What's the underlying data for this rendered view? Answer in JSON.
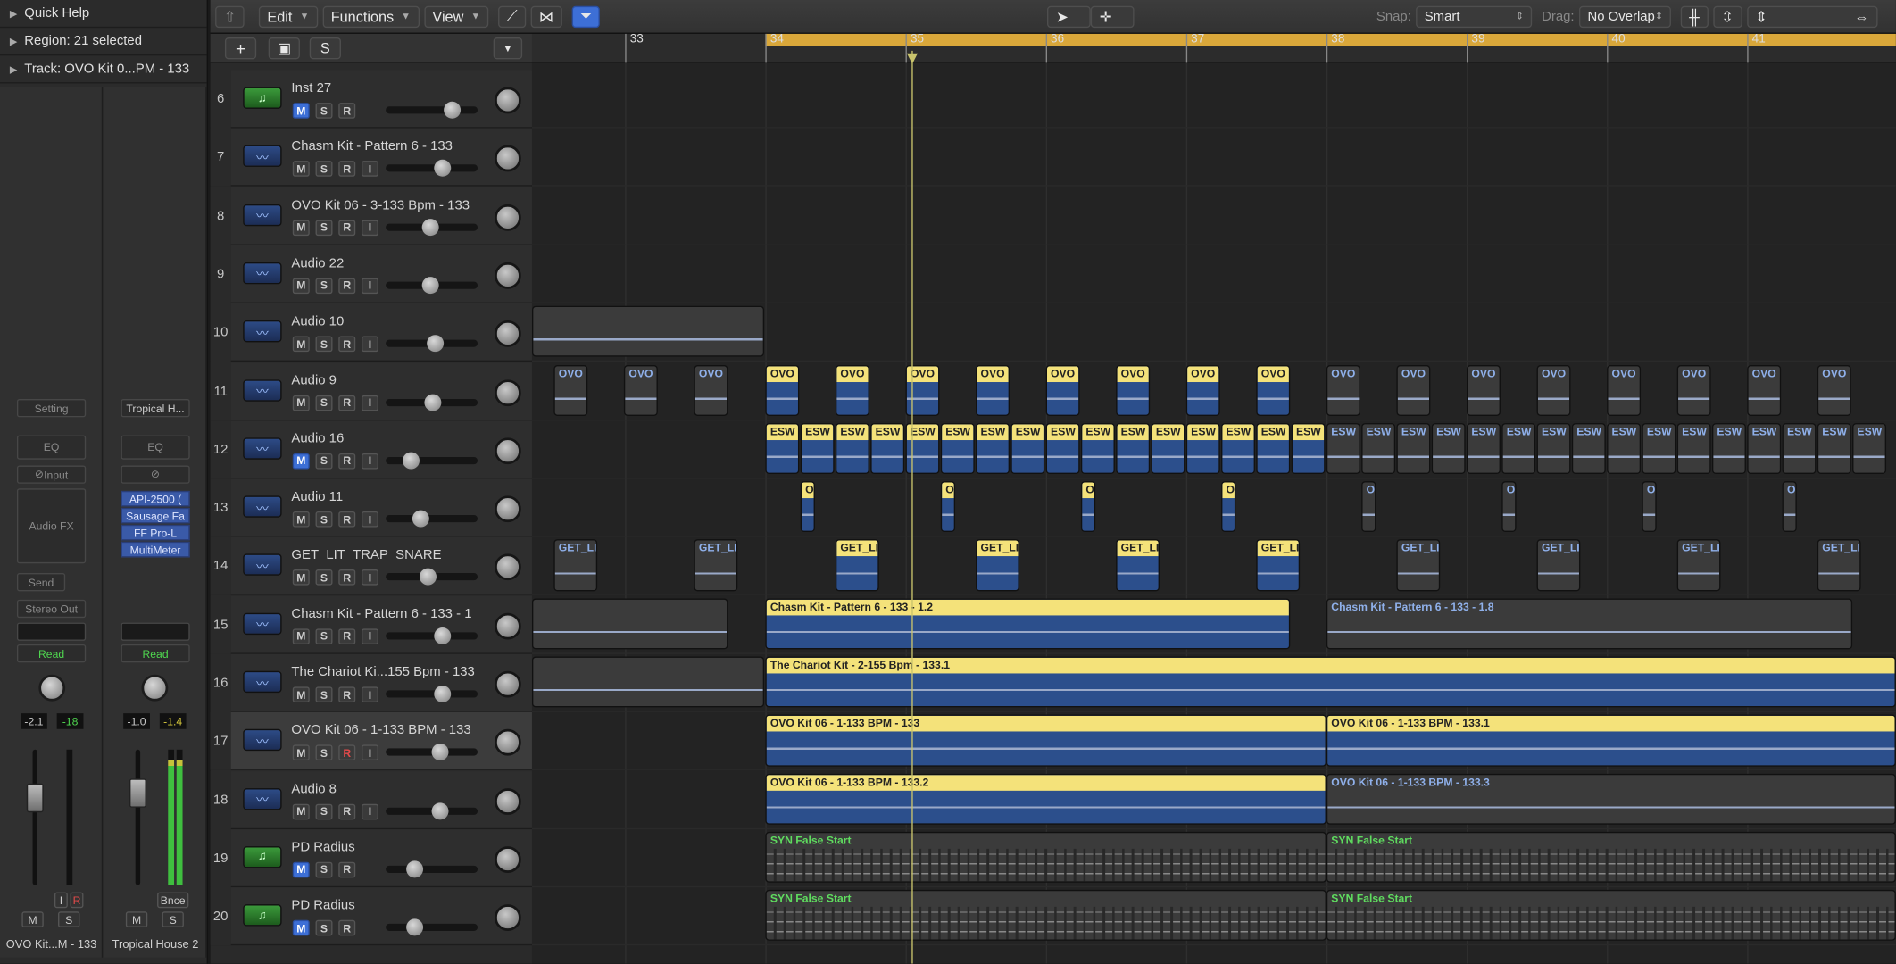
{
  "inspector": {
    "quick_help": "Quick Help",
    "region": "Region: 21 selected",
    "track": "Track:  OVO Kit 0...PM - 133",
    "strip1": {
      "setting": "Setting",
      "eq": "EQ",
      "input": "Input",
      "audio_fx": "Audio FX",
      "send": "Send",
      "output": "Stereo Out",
      "automation": "Read",
      "knob_val": "-18",
      "vol": "-2.1",
      "peak": "-18",
      "m": "M",
      "s": "S",
      "i": "I",
      "r": "R",
      "name": "OVO Kit...M - 133"
    },
    "strip2": {
      "setting": "Tropical H...",
      "eq": "EQ",
      "plugins": [
        "API-2500 (",
        "Sausage Fa",
        "FF Pro-L",
        "MultiMeter"
      ],
      "automation": "Read",
      "vol": "-1.0",
      "peak": "-1.4",
      "bnce": "Bnce",
      "m": "M",
      "s": "S",
      "name": "Tropical House 2"
    }
  },
  "toolbar": {
    "edit": "Edit",
    "functions": "Functions",
    "view": "View",
    "snap_label": "Snap:",
    "snap_value": "Smart",
    "drag_label": "Drag:",
    "drag_value": "No Overlap"
  },
  "header": {
    "add": "+",
    "s": "S"
  },
  "ruler": {
    "bars": [
      "33",
      "34",
      "35",
      "36",
      "37",
      "38",
      "39",
      "40",
      "41"
    ]
  },
  "tracks": [
    {
      "num": "6",
      "name": "Inst 27",
      "type": "midi",
      "btns": [
        "M",
        "S",
        "R"
      ],
      "vol": 0.78
    },
    {
      "num": "7",
      "name": "Chasm Kit - Pattern 6 - 133",
      "type": "audio",
      "btns": [
        "M",
        "S",
        "R",
        "I"
      ],
      "vol": 0.65
    },
    {
      "num": "8",
      "name": "OVO Kit 06 - 3-133 Bpm - 133",
      "type": "audio",
      "btns": [
        "M",
        "S",
        "R",
        "I"
      ],
      "vol": 0.48
    },
    {
      "num": "9",
      "name": "Audio 22",
      "type": "audio",
      "btns": [
        "M",
        "S",
        "R",
        "I"
      ],
      "vol": 0.48
    },
    {
      "num": "10",
      "name": "Audio 10",
      "type": "audio",
      "btns": [
        "M",
        "S",
        "R",
        "I"
      ],
      "vol": 0.55
    },
    {
      "num": "11",
      "name": "Audio 9",
      "type": "audio",
      "btns": [
        "M",
        "S",
        "R",
        "I"
      ],
      "vol": 0.52
    },
    {
      "num": "12",
      "name": "Audio 16",
      "type": "audio",
      "btns": [
        "M",
        "S",
        "R",
        "I"
      ],
      "vol": 0.22
    },
    {
      "num": "13",
      "name": "Audio 11",
      "type": "audio",
      "btns": [
        "M",
        "S",
        "R",
        "I"
      ],
      "vol": 0.35
    },
    {
      "num": "14",
      "name": "GET_LIT_TRAP_SNARE",
      "type": "audio",
      "btns": [
        "M",
        "S",
        "R",
        "I"
      ],
      "vol": 0.45
    },
    {
      "num": "15",
      "name": "Chasm Kit - Pattern 6 - 133 - 1",
      "type": "audio",
      "btns": [
        "M",
        "S",
        "R",
        "I"
      ],
      "vol": 0.65
    },
    {
      "num": "16",
      "name": "The Chariot Ki...155 Bpm - 133",
      "type": "audio",
      "btns": [
        "M",
        "S",
        "R",
        "I"
      ],
      "vol": 0.65
    },
    {
      "num": "17",
      "name": "OVO Kit 06 - 1-133 BPM - 133",
      "type": "audio",
      "btns": [
        "M",
        "S",
        "R",
        "I"
      ],
      "vol": 0.62,
      "selected": true
    },
    {
      "num": "18",
      "name": "Audio 8",
      "type": "audio",
      "btns": [
        "M",
        "S",
        "R",
        "I"
      ],
      "vol": 0.62
    },
    {
      "num": "19",
      "name": "PD Radius",
      "type": "midi",
      "btns": [
        "M",
        "S",
        "R"
      ],
      "vol": 0.28
    },
    {
      "num": "20",
      "name": "PD Radius",
      "type": "midi",
      "btns": [
        "M",
        "S",
        "R"
      ],
      "vol": 0.28
    }
  ],
  "regions": {
    "ovo_short": "OVO",
    "ovo_cut": "OVO I",
    "esw": "ESW",
    "ov": "OV",
    "o": "O",
    "getlit": "GET_LI",
    "getlit2": "GET_LIT",
    "chasm_1": "Chasm Kit - Pattern 6 - 133 - 1.2",
    "chasm_2": "Chasm Kit - Pattern 6 - 133 - 1.8",
    "chariot": "The Chariot Kit - 2-155 Bpm - 133.1",
    "ovo17a": "OVO Kit 06 - 1-133 BPM - 133",
    "ovo17b": "OVO Kit 06 - 1-133 BPM - 133.1",
    "ovo18a": "OVO Kit 06 - 1-133 BPM - 133.2",
    "ovo18b": "OVO Kit 06 - 1-133 BPM - 133.3",
    "syn": "SYN False Start"
  },
  "colors": {
    "accent": "#3d6fd6",
    "cycle": "#d9a73a",
    "selected_region": "#f4e27a",
    "midi": "#5fdc5f"
  }
}
